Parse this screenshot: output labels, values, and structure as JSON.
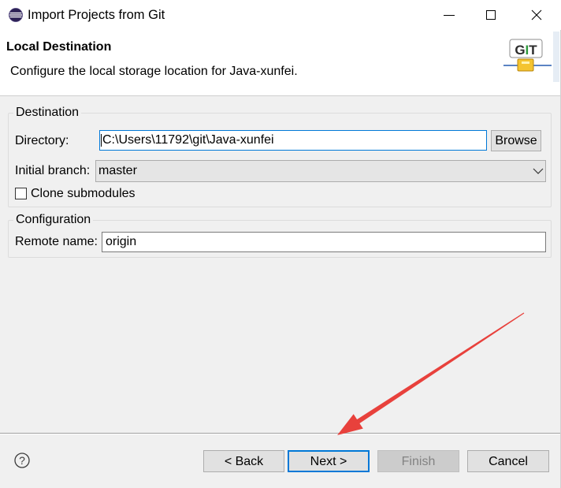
{
  "window": {
    "title": "Import Projects from Git",
    "app_icon": "eclipse-icon",
    "controls": [
      "minimize-icon",
      "maximize-icon",
      "close-icon"
    ]
  },
  "header": {
    "title": "Local Destination",
    "description": "Configure the local storage location for Java-xunfei.",
    "banner_icon": "git-banner-icon",
    "banner_text": "GIT"
  },
  "destination": {
    "legend": "Destination",
    "directory": {
      "label": "Directory:",
      "value": "C:\\Users\\11792\\git\\Java-xunfei",
      "focused": true
    },
    "browse_button": "Browse",
    "initial_branch": {
      "label": "Initial branch:",
      "value": "master",
      "icon": "chevron-down-icon"
    },
    "clone_submodules": {
      "label": "Clone submodules",
      "checked": false
    }
  },
  "configuration": {
    "legend": "Configuration",
    "remote_name": {
      "label": "Remote name:",
      "value": "origin"
    }
  },
  "footer": {
    "help_icon": "help-icon",
    "help_glyph": "?",
    "buttons": {
      "back": {
        "label": "< Back",
        "enabled": true
      },
      "next": {
        "label": "Next >",
        "enabled": true,
        "default": true
      },
      "finish": {
        "label": "Finish",
        "enabled": false
      },
      "cancel": {
        "label": "Cancel",
        "enabled": true
      }
    }
  },
  "annotation": {
    "icon": "annotation-arrow-icon",
    "color": "#e8413c"
  },
  "colors": {
    "accent": "#0078d7",
    "panel_background": "#f0f0f0",
    "header_background": "#ffffff",
    "disabled_text": "#838383",
    "banner_letters": [
      "#2b2b2b",
      "#2e9a3c",
      "#2b2b2b"
    ]
  }
}
